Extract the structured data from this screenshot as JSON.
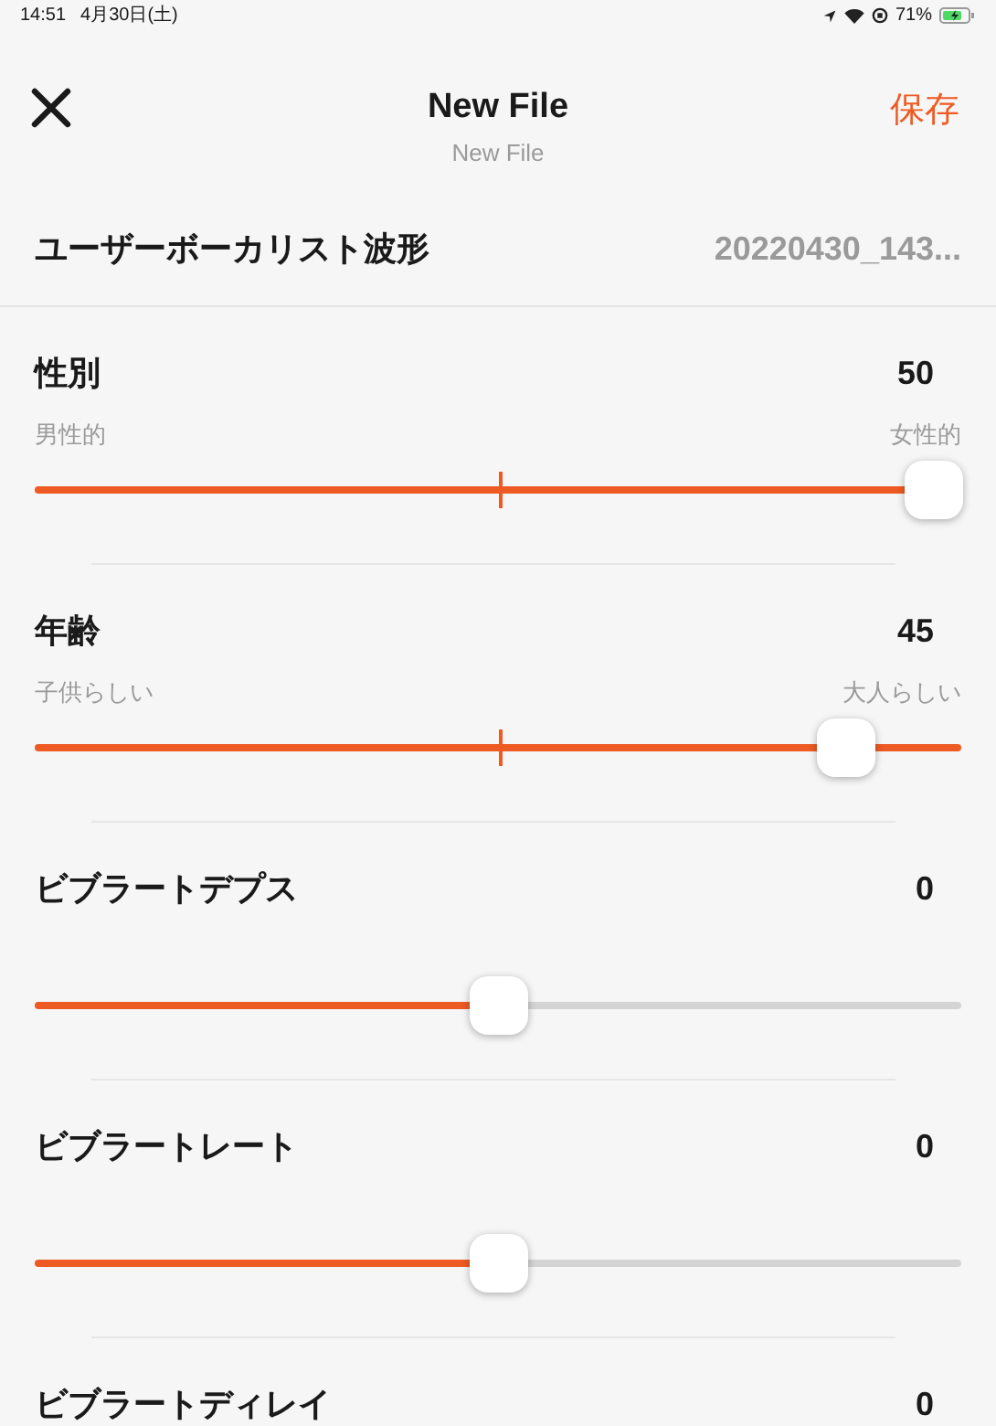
{
  "status_bar": {
    "time": "14:51",
    "date": "4月30日(土)",
    "battery": "71%"
  },
  "header": {
    "title": "New File",
    "subtitle": "New File",
    "save": "保存"
  },
  "file_row": {
    "label": "ユーザーボーカリスト波形",
    "value": "20220430_143..."
  },
  "sliders": [
    {
      "kind": "bipolar",
      "title": "性別",
      "value": "50",
      "min_label": "男性的",
      "max_label": "女性的",
      "level": 0.97
    },
    {
      "kind": "bipolar",
      "title": "年齢",
      "value": "45",
      "min_label": "子供らしい",
      "max_label": "大人らしい",
      "level": 0.876
    },
    {
      "kind": "unipolar",
      "title": "ビブラートデプス",
      "value": "0",
      "level": 0.5
    },
    {
      "kind": "unipolar",
      "title": "ビブラートレート",
      "value": "0",
      "level": 0.5
    },
    {
      "kind": "cut",
      "title": "ビブラートディレイ",
      "value": "0"
    }
  ]
}
